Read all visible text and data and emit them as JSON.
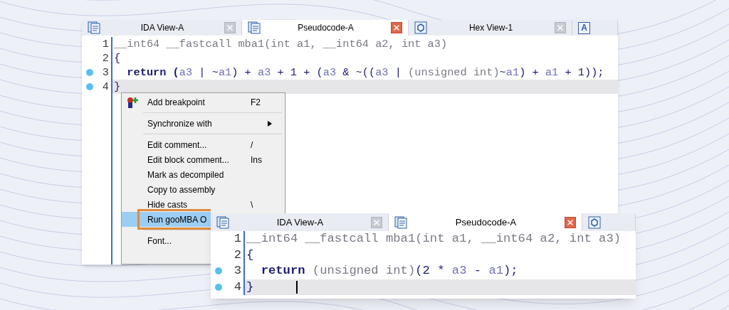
{
  "back_window": {
    "tabs": [
      {
        "label": "IDA View-A",
        "kind": "listing",
        "selected": false
      },
      {
        "label": "Pseudocode-A",
        "kind": "listing",
        "selected": true
      },
      {
        "label": "Hex View-1",
        "kind": "hex",
        "selected": false
      },
      {
        "kind": "letter",
        "icon_text": "A",
        "selected": false
      }
    ],
    "code": [
      {
        "number": "1",
        "breakpoint": false,
        "current": false,
        "caret": false,
        "tokens": [
          {
            "text": "__int64 __fastcall mba1(int a1, __int64 a2, int a3)",
            "kind": "type"
          }
        ]
      },
      {
        "number": "2",
        "breakpoint": false,
        "current": false,
        "caret": false,
        "tokens": [
          {
            "text": "{",
            "kind": "plain"
          }
        ]
      },
      {
        "number": "3",
        "breakpoint": true,
        "current": false,
        "caret": false,
        "tokens": [
          {
            "text": "  return (",
            "kind": "plain"
          },
          {
            "text": "a3",
            "kind": "var"
          },
          {
            "text": " | ~",
            "kind": "plain"
          },
          {
            "text": "a1",
            "kind": "var"
          },
          {
            "text": ") + ",
            "kind": "plain"
          },
          {
            "text": "a3",
            "kind": "var"
          },
          {
            "text": " + 1 + (",
            "kind": "plain"
          },
          {
            "text": "a3",
            "kind": "var"
          },
          {
            "text": " & ~((",
            "kind": "plain"
          },
          {
            "text": "a3",
            "kind": "var"
          },
          {
            "text": " | ",
            "kind": "plain"
          },
          {
            "text": "(unsigned int)",
            "kind": "type"
          },
          {
            "text": "~",
            "kind": "plain"
          },
          {
            "text": "a1",
            "kind": "var"
          },
          {
            "text": ") + ",
            "kind": "plain"
          },
          {
            "text": "a1",
            "kind": "var"
          },
          {
            "text": " + 1));",
            "kind": "plain"
          }
        ]
      },
      {
        "number": "4",
        "breakpoint": true,
        "current": true,
        "caret": false,
        "tokens": [
          {
            "text": "}",
            "kind": "plain"
          }
        ]
      }
    ]
  },
  "context_menu": [
    {
      "kind": "breakpoint_command",
      "label": "Add breakpoint",
      "shortcut": "F2",
      "selected": false
    },
    {
      "kind": "separator"
    },
    {
      "kind": "submenu",
      "label": "Synchronize with",
      "selected": false
    },
    {
      "kind": "separator"
    },
    {
      "kind": "command",
      "label": "Edit comment...",
      "shortcut": "/",
      "selected": false
    },
    {
      "kind": "command",
      "label": "Edit block comment...",
      "shortcut": "Ins",
      "selected": false
    },
    {
      "kind": "command",
      "label": "Mark as decompiled",
      "selected": false
    },
    {
      "kind": "command",
      "label": "Copy to assembly",
      "selected": false
    },
    {
      "kind": "command",
      "label": "Hide casts",
      "shortcut": "\\",
      "selected": false
    },
    {
      "kind": "command",
      "label": "Run gooMBA O",
      "selected": true,
      "outlined": true
    },
    {
      "kind": "separator"
    },
    {
      "kind": "command",
      "label": "Font...",
      "selected": false
    }
  ],
  "front_window": {
    "tabs": [
      {
        "label": "IDA View-A",
        "kind": "listing",
        "selected": false
      },
      {
        "label": "Pseudocode-A",
        "kind": "listing",
        "selected": true
      },
      {
        "kind": "hex",
        "selected": false
      }
    ],
    "code": [
      {
        "number": "1",
        "breakpoint": false,
        "current": false,
        "caret": false,
        "tokens": [
          {
            "text": "__int64 __fastcall mba1(int a1, __int64 a2, int a3)",
            "kind": "type"
          }
        ]
      },
      {
        "number": "2",
        "breakpoint": false,
        "current": false,
        "caret": false,
        "tokens": [
          {
            "text": "{",
            "kind": "plain"
          }
        ]
      },
      {
        "number": "3",
        "breakpoint": true,
        "current": false,
        "caret": false,
        "tokens": [
          {
            "text": "  return ",
            "kind": "plain"
          },
          {
            "text": "(unsigned int)",
            "kind": "type"
          },
          {
            "text": "(2 * ",
            "kind": "plain"
          },
          {
            "text": "a3",
            "kind": "var"
          },
          {
            "text": " - ",
            "kind": "plain"
          },
          {
            "text": "a1",
            "kind": "var"
          },
          {
            "text": ");",
            "kind": "plain"
          }
        ]
      },
      {
        "number": "4",
        "breakpoint": true,
        "current": true,
        "caret": true,
        "tokens": [
          {
            "text": "}",
            "kind": "plain"
          }
        ]
      }
    ]
  }
}
